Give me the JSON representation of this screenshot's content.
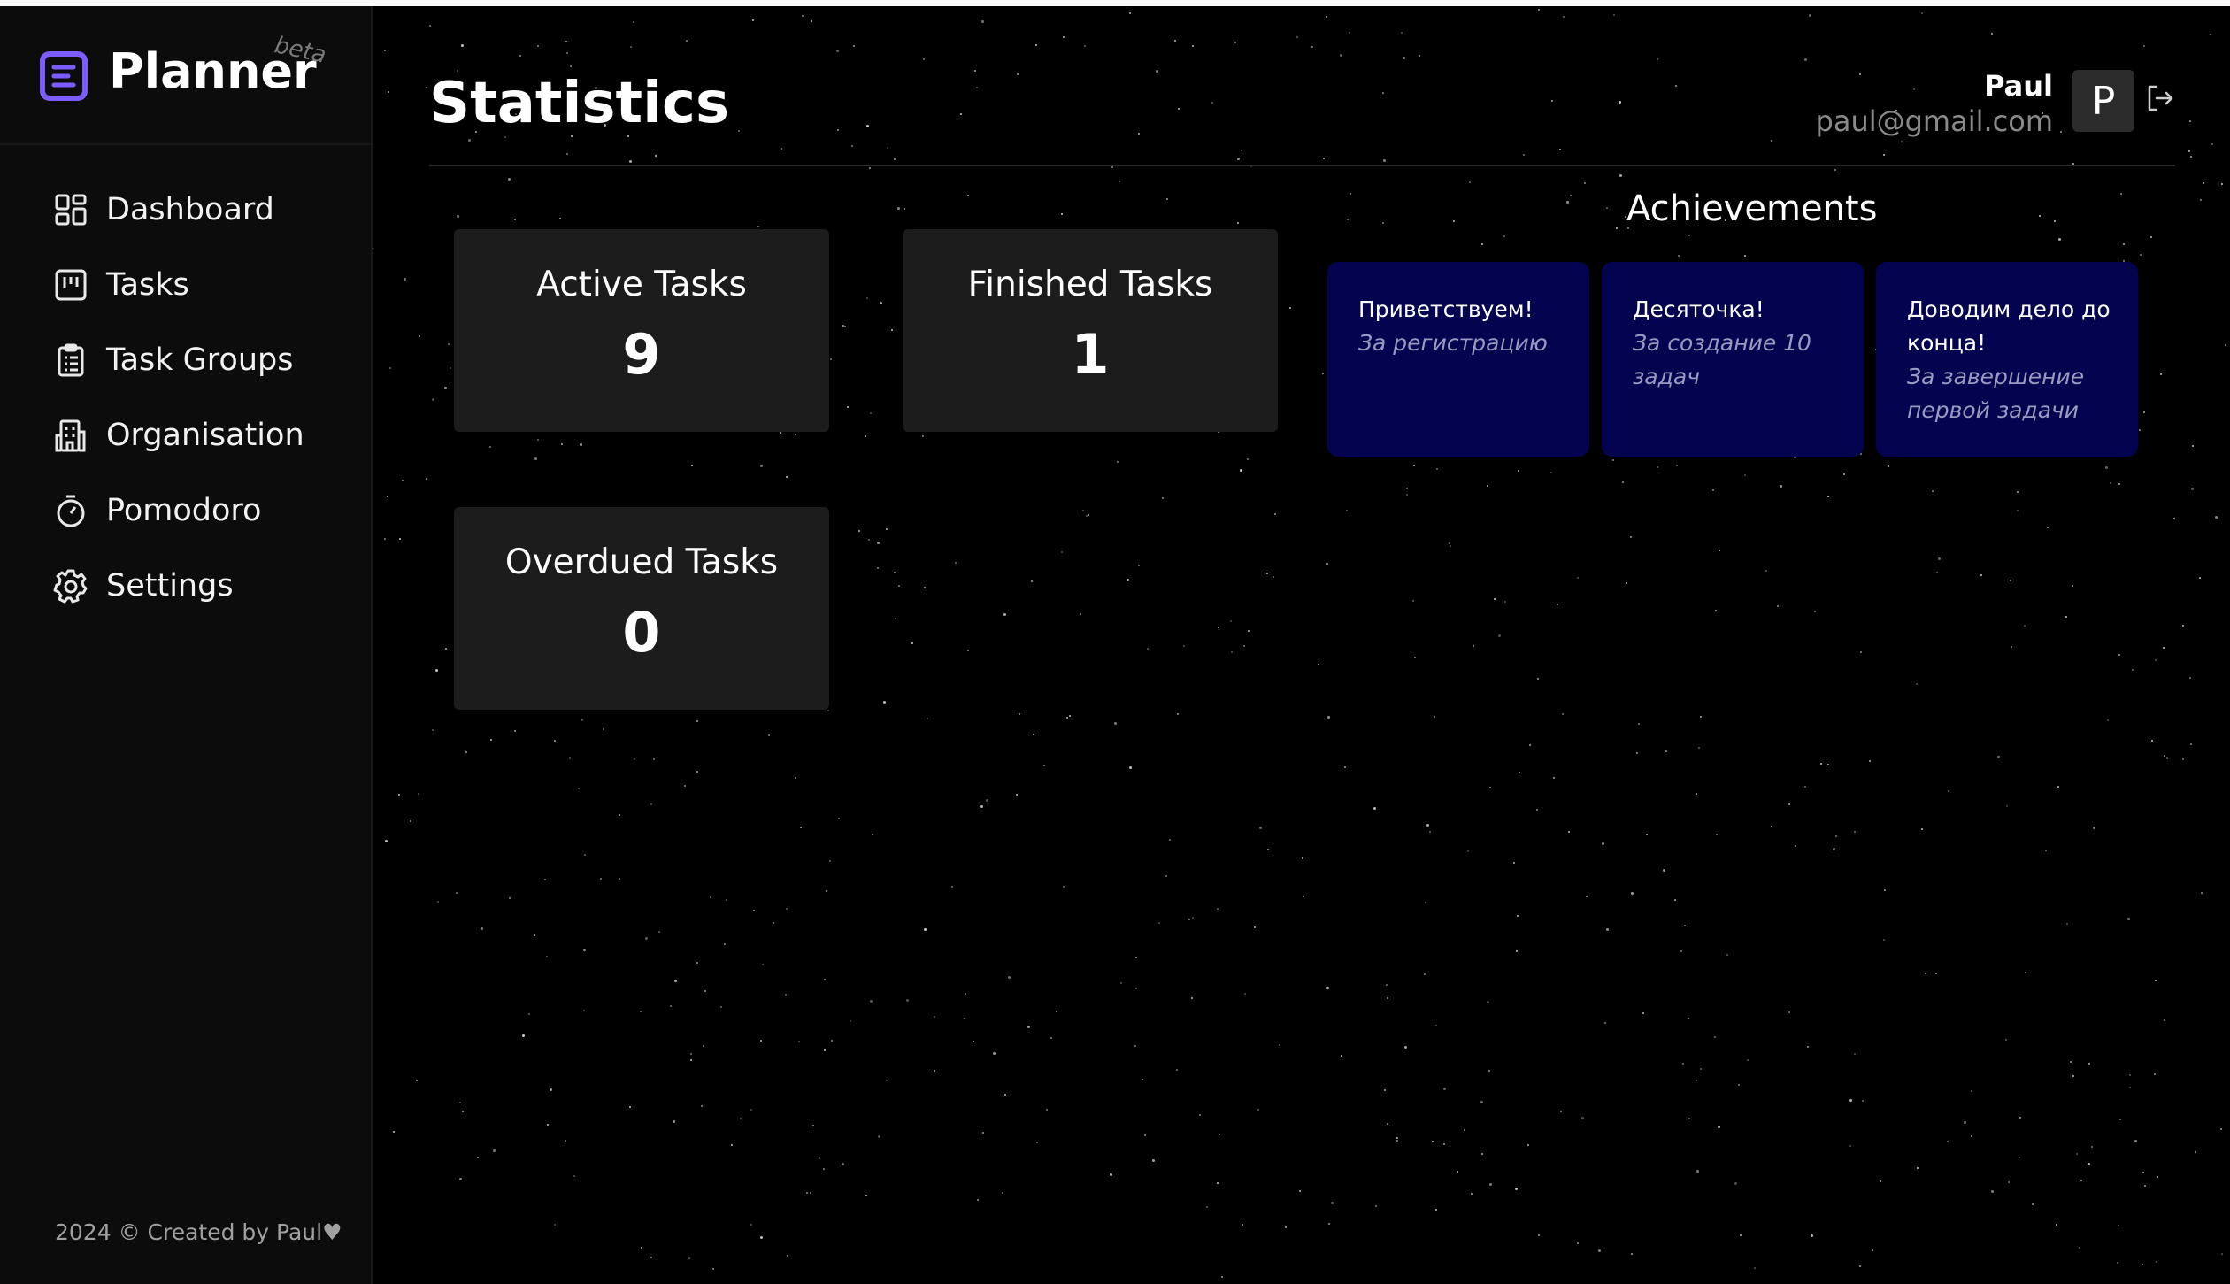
{
  "app": {
    "name": "Planner",
    "badge": "beta"
  },
  "sidebar": {
    "items": [
      {
        "label": "Dashboard",
        "icon": "dashboard-icon"
      },
      {
        "label": "Tasks",
        "icon": "kanban-icon"
      },
      {
        "label": "Task Groups",
        "icon": "clipboard-list-icon"
      },
      {
        "label": "Organisation",
        "icon": "building-icon"
      },
      {
        "label": "Pomodoro",
        "icon": "timer-icon"
      },
      {
        "label": "Settings",
        "icon": "gear-icon"
      }
    ],
    "footer": "2024 © Created by Paul♥"
  },
  "header": {
    "title": "Statistics",
    "user": {
      "name": "Paul",
      "email": "paul@gmail.com",
      "avatar_initial": "P"
    },
    "logout_icon": "logout-icon"
  },
  "stats": {
    "active": {
      "label": "Active Tasks",
      "value": "9"
    },
    "finished": {
      "label": "Finished Tasks",
      "value": "1"
    },
    "overdue": {
      "label": "Overdued Tasks",
      "value": "0"
    }
  },
  "achievements": {
    "title": "Achievements",
    "items": [
      {
        "name": "Приветствуем!",
        "description": "За регистрацию"
      },
      {
        "name": "Десяточка!",
        "description": "За создание 10 задач"
      },
      {
        "name": "Доводим дело до конца!",
        "description": "За завершение первой задачи"
      }
    ]
  },
  "colors": {
    "accent": "#7c5cff",
    "background": "#000000",
    "sidebar": "#0c0c0d",
    "card": "#1c1c1c",
    "achievement_card": "#03034f"
  }
}
